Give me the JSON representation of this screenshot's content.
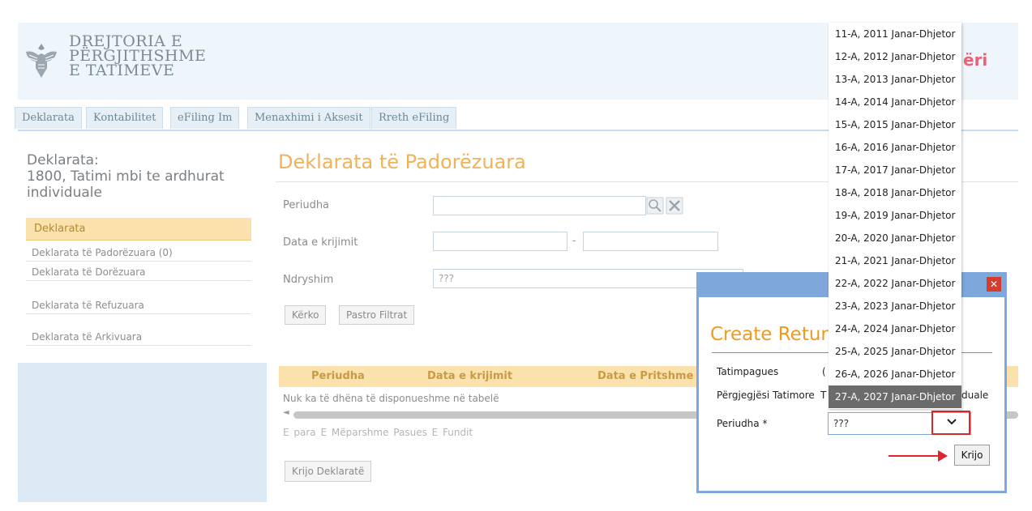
{
  "header": {
    "logo_line1": "DREJTORIA E",
    "logo_line2": "PËRGJITHSHME",
    "logo_line3": "E TATIMEVE",
    "right_text": "ëri"
  },
  "tabs": [
    {
      "label": "Deklarata"
    },
    {
      "label": "Kontabilitet"
    },
    {
      "label": "eFiling Im"
    },
    {
      "label": "Menaxhimi i Aksesit"
    },
    {
      "label": "Rreth eFiling"
    }
  ],
  "sidebar": {
    "title_line1": "Deklarata:",
    "title_line2": "1800, Tatimi mbi te ardhurat",
    "title_line3": "individuale",
    "section": "Deklarata",
    "items": [
      {
        "label": "Deklarata të Padorëzuara (0)"
      },
      {
        "label": "Deklarata të Dorëzuara"
      },
      {
        "label": "Deklarata të Refuzuara"
      },
      {
        "label": "Deklarata të Arkivuara"
      }
    ]
  },
  "main": {
    "title": "Deklarata të Padorëzuara",
    "filters": {
      "periudha_label": "Periudha",
      "data_label": "Data e krijimit",
      "dash": "-",
      "ndryshim_label": "Ndryshim",
      "ndryshim_value": "???"
    },
    "search_button": "Kërko",
    "clear_button": "Pastro Filtrat",
    "grid": {
      "columns": [
        "Periudha",
        "Data e krijimit",
        "Data e Pritshme e"
      ],
      "empty_text": "Nuk ka të dhëna të disponueshme në tabelë"
    },
    "pager": {
      "first": "E para",
      "prev": "E Mëparshme",
      "next": "Pasues",
      "last": "E Fundit"
    },
    "create_button": "Krijo Deklaratë"
  },
  "modal": {
    "title": "Create Retur",
    "taxpayer_label": "Tatimpagues",
    "taxpayer_value": "(",
    "responsible_label": "Përgjegjësi Tatimore",
    "responsible_value_left": "T",
    "responsible_value_right": "duale",
    "period_label": "Periudha *",
    "period_value": "???",
    "create_button": "Krijo"
  },
  "dropdown": {
    "options": [
      "11-A, 2011 Janar-Dhjetor",
      "12-A, 2012 Janar-Dhjetor",
      "13-A, 2013 Janar-Dhjetor",
      "14-A, 2014 Janar-Dhjetor",
      "15-A, 2015 Janar-Dhjetor",
      "16-A, 2016 Janar-Dhjetor",
      "17-A, 2017 Janar-Dhjetor",
      "18-A, 2018 Janar-Dhjetor",
      "19-A, 2019 Janar-Dhjetor",
      "20-A, 2020 Janar-Dhjetor",
      "21-A, 2021 Janar-Dhjetor",
      "22-A, 2022 Janar-Dhjetor",
      "23-A, 2023 Janar-Dhjetor",
      "24-A, 2024 Janar-Dhjetor",
      "25-A, 2025 Janar-Dhjetor",
      "26-A, 2026 Janar-Dhjetor",
      "27-A, 2027 Janar-Dhjetor"
    ],
    "selected": "27-A, 2027 Janar-Dhjetor"
  },
  "colors": {
    "accent_orange": "#ef9a22",
    "modal_border": "#7ea7dc",
    "highlight_red": "#d9272e"
  }
}
